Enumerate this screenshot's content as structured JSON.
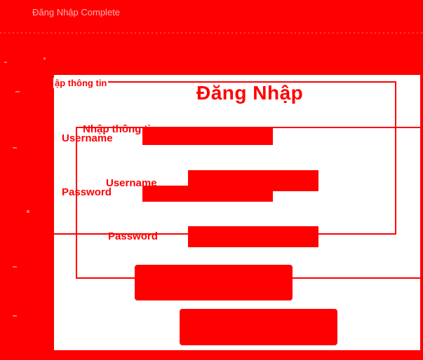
{
  "window": {
    "title": "Đăng Nhập Complete"
  },
  "login": {
    "group_legend": "ập thông tin",
    "heading": "Đăng Nhập",
    "info_label": "Nhập thông tin",
    "username_label": "Username",
    "password_label": "Password",
    "inner_username_label": "Username",
    "inner_password_label": "Password",
    "username_value": "",
    "password_value": ""
  },
  "buttons": {
    "login_label": "",
    "register_label": ""
  }
}
